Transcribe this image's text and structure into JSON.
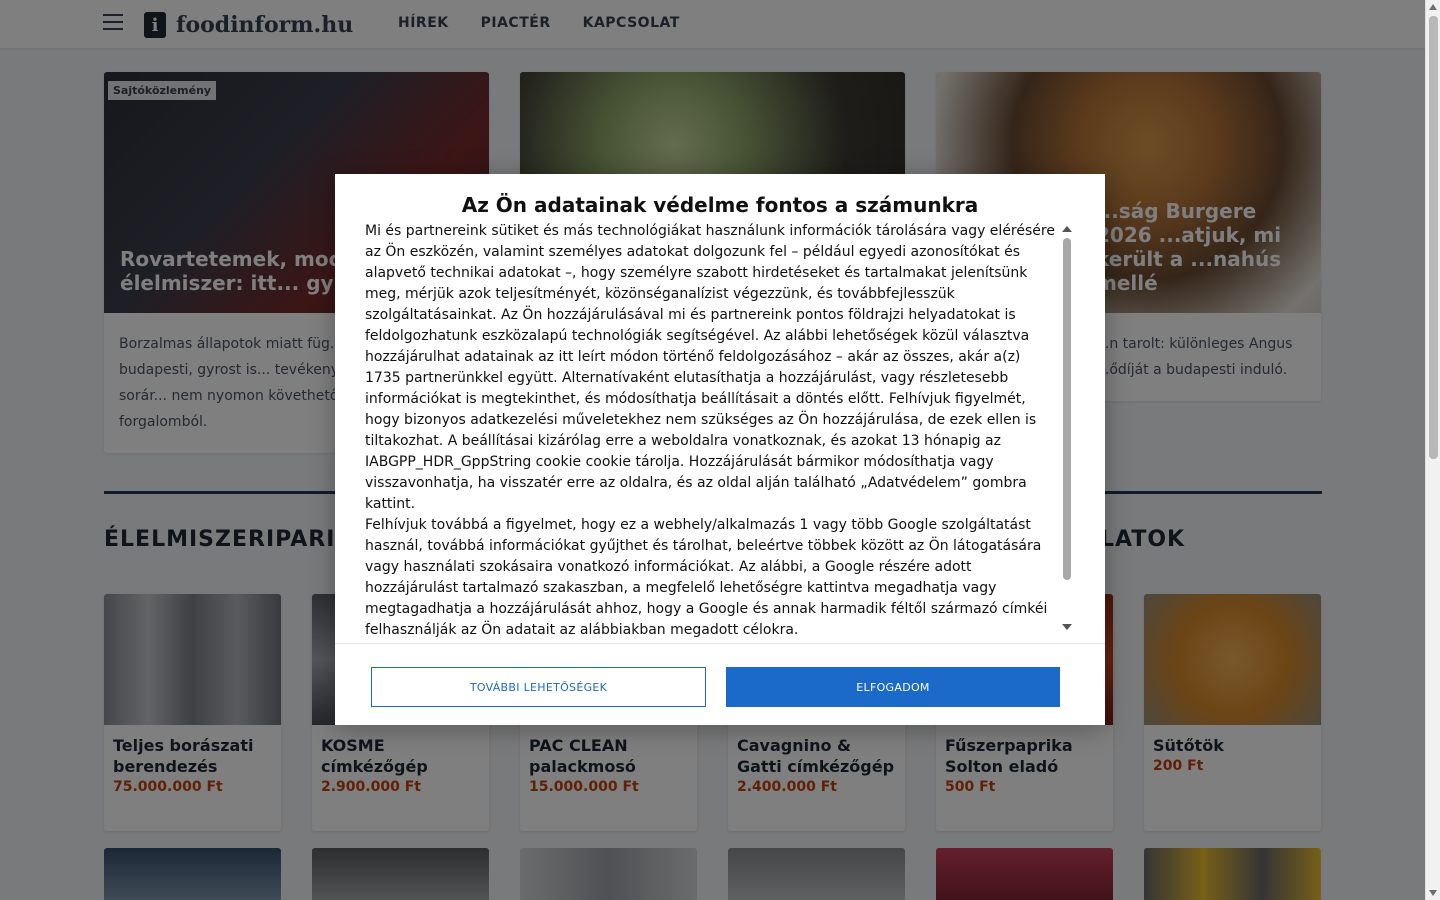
{
  "header": {
    "logo_text": "foodinform.hu",
    "nav": [
      "HÍREK",
      "PIACTÉR",
      "KAPCSOLAT"
    ]
  },
  "featured": [
    {
      "badge": "Sajtóközlemény",
      "title": "Rovartetemek, mocs... tonna élelmiszer: itt... gyroshús",
      "lead": "Borzalmas állapotok miatt füg... Nébih egy budapesti, gyrost is... tevékenységét. Az akció sorár... nem nyomon követhető élelm... forgalomból."
    },
    {
      "badge": "",
      "title": "",
      "lead": ""
    },
    {
      "badge": "",
      "title": "...ság Burgere 2026 ...atjuk, mi került a ...nahús mellé",
      "lead": "...n tarolt: különleges Angus ...ődíját a budapesti induló."
    }
  ],
  "sections": {
    "left_title": "ÉLELMISZERIPARI G",
    "right_title": "LATOK"
  },
  "market": [
    {
      "name": "Teljes borászati berendezés",
      "price": "75.000.000 Ft"
    },
    {
      "name": "KOSME címkézőgép",
      "price": "2.900.000 Ft"
    },
    {
      "name": "PAC CLEAN palackmosó",
      "price": "15.000.000 Ft"
    },
    {
      "name": "Cavagnino & Gatti címkézőgép",
      "price": "2.400.000 Ft"
    },
    {
      "name": "Fűszerpaprika Solton eladó",
      "price": "500 Ft"
    },
    {
      "name": "Sütőtök",
      "price": "200 Ft"
    }
  ],
  "consent": {
    "title": "Az Ön adatainak védelme fontos a számunkra",
    "paragraph1": "Mi és partnereink sütiket és más technológiákat használunk információk tárolására vagy elérésére az Ön eszközén, valamint személyes adatokat dolgozunk fel – például egyedi azonosítókat és alapvető technikai adatokat –, hogy személyre szabott hirdetéseket és tartalmakat jelenítsünk meg, mérjük azok teljesítményét, közönséganalízist végezzünk, és továbbfejlesszük szolgáltatásainkat. Az Ön hozzájárulásával mi és partnereink pontos földrajzi helyadatokat is feldolgozhatunk eszközalapú technológiák segítségével. Az alábbi lehetőségek közül választva hozzájárulhat adatainak az itt leírt módon történő feldolgozásához – akár az összes, akár a(z) 1735 partnerünkkel együtt. Alternatívaként elutasíthatja a hozzájárulást, vagy részletesebb információkat is megtekinthet, és módosíthatja beállításait a döntés előtt. Felhívjuk figyelmét, hogy bizonyos adatkezelési műveletekhez nem szükséges az Ön hozzájárulása, de ezek ellen is tiltakozhat. A beállításai kizárólag erre a weboldalra vonatkoznak, és azokat 13 hónapig az IABGPP_HDR_GppString cookie cookie tárolja. Hozzájárulását bármikor módosíthatja vagy visszavonhatja, ha visszatér erre az oldalra, és az oldal alján található „Adatvédelem” gombra kattint.",
    "paragraph2": "Felhívjuk továbbá a figyelmet, hogy ez a webhely/alkalmazás 1 vagy több Google szolgáltatást használ, továbbá információkat gyűjthet és tárolhat, beleértve többek között az Ön látogatására vagy használati szokásaira vonatkozó információkat. Az alábbi, a Google részére adott hozzájárulást tartalmazó szakaszban, a megfelelő lehetőségre kattintva megadhatja vagy megtagadhatja a hozzájárulását ahhoz, hogy a Google és annak harmadik féltől származó címkéi felhasználják az Ön adatait az alábbiakban megadott célokra.",
    "more_options": "TOVÁBBI LEHETŐSÉGEK",
    "accept": "ELFOGADOM"
  }
}
